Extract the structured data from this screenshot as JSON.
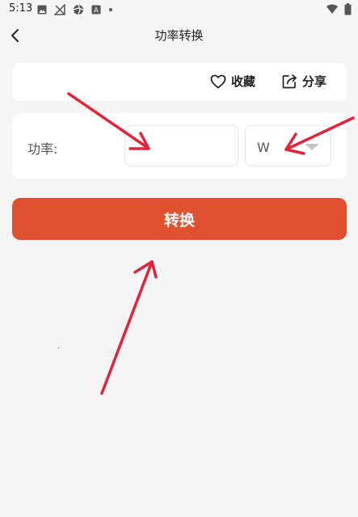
{
  "status_bar": {
    "time": "5:13",
    "left_icons": [
      "image-icon",
      "no-signal-icon",
      "aperture-icon",
      "a-box-icon",
      "dot-icon"
    ],
    "right_icons": [
      "wifi-icon",
      "battery-icon"
    ]
  },
  "header": {
    "title": "功率转换",
    "back_icon": "chevron-left-icon"
  },
  "actions": {
    "favorite_label": "收藏",
    "favorite_icon": "heart-outline-icon",
    "share_label": "分享",
    "share_icon": "share-icon"
  },
  "form": {
    "power_label": "功率:",
    "power_input_value": "",
    "unit_selected": "W"
  },
  "convert_button_label": "转换",
  "colors": {
    "background": "#f5f5f5",
    "card": "#ffffff",
    "accent": "#e1502f",
    "annotation_arrow": "#e0243a"
  },
  "annotations": {
    "arrows": [
      {
        "points_to": "power-input"
      },
      {
        "points_to": "unit-select"
      },
      {
        "points_to": "convert-button"
      }
    ]
  }
}
